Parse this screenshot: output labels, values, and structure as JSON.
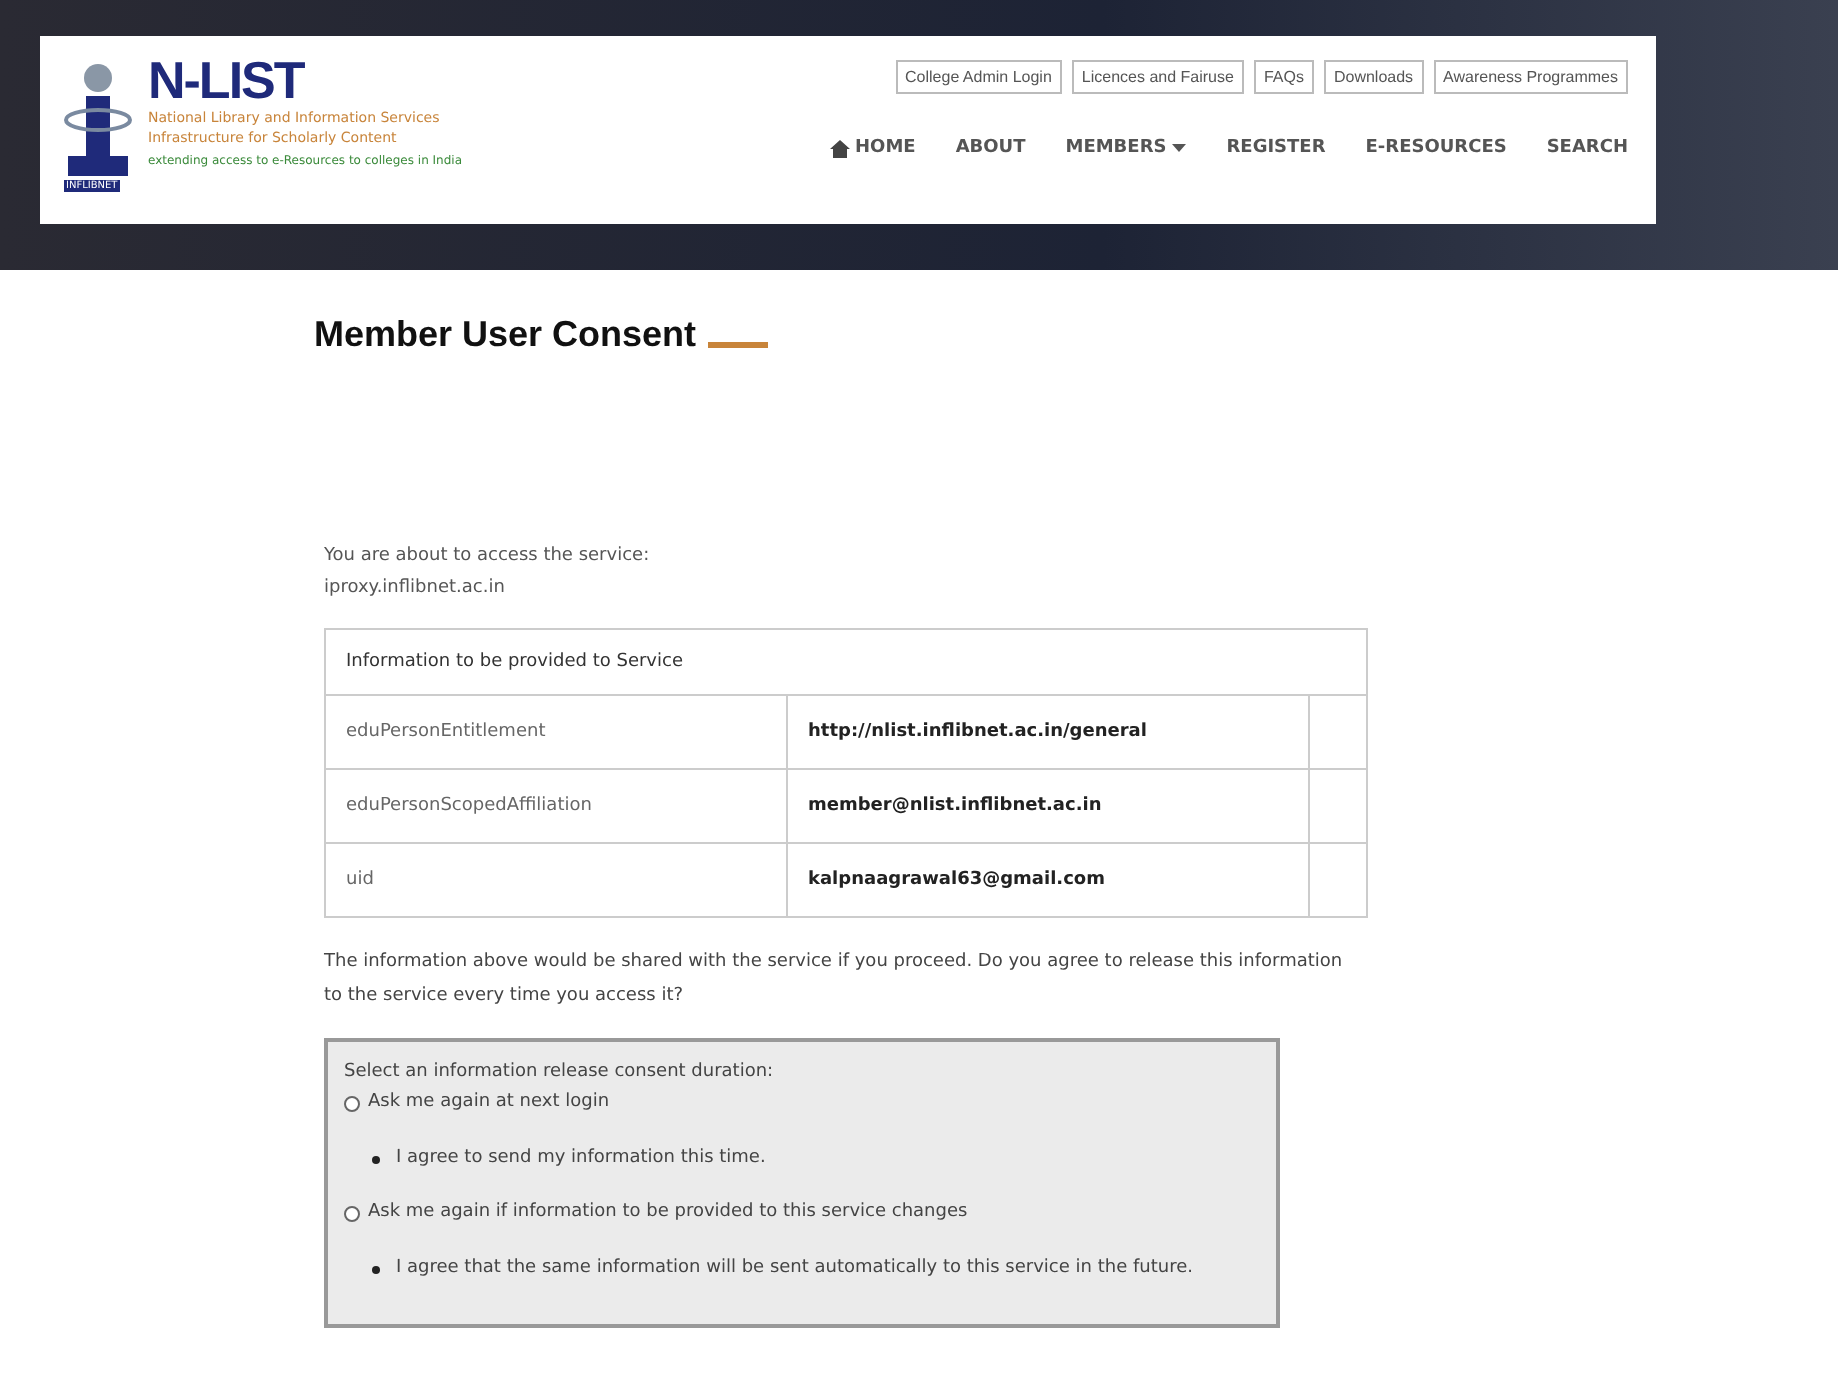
{
  "header": {
    "logo": {
      "title": "N-LIST",
      "subtitle_lines": [
        "National Library and Information Services",
        "Infrastructure for Scholarly Content"
      ],
      "tagline": "extending access to e-Resources to colleges in India",
      "emblem_caption": "INFLIBNET"
    },
    "top_links": [
      "College Admin Login",
      "Licences and Fairuse",
      "FAQs",
      "Downloads",
      "Awareness Programmes"
    ],
    "nav": [
      {
        "label": "HOME",
        "kind": "home"
      },
      {
        "label": "ABOUT",
        "kind": "plain"
      },
      {
        "label": "MEMBERS",
        "kind": "dropdown"
      },
      {
        "label": "REGISTER",
        "kind": "plain"
      },
      {
        "label": "E-RESOURCES",
        "kind": "plain"
      },
      {
        "label": "SEARCH",
        "kind": "plain"
      }
    ]
  },
  "page_title": "Member User Consent",
  "intro": {
    "line": "You are about to access the service:",
    "service": "iproxy.inflibnet.ac.in"
  },
  "table": {
    "heading": "Information to be provided to Service",
    "rows": [
      {
        "attribute": "eduPersonEntitlement",
        "value": "http://nlist.inflibnet.ac.in/general"
      },
      {
        "attribute": "eduPersonScopedAffiliation",
        "value": "member@nlist.inflibnet.ac.in"
      },
      {
        "attribute": "uid",
        "value": "kalpnaagrawal63@gmail.com"
      }
    ]
  },
  "question": "The information above would be shared with the service if you proceed. Do you agree to release this information to the service every time you access it?",
  "consent": {
    "prompt": "Select an information release consent duration:",
    "options": [
      {
        "label": "Ask me again at next login",
        "selected": false,
        "detail": "I agree to send my information this time."
      },
      {
        "label": "Ask me again if information to be provided to this service changes",
        "selected": false,
        "detail": "I agree that the same information will be sent automatically to this service in the future."
      }
    ]
  }
}
